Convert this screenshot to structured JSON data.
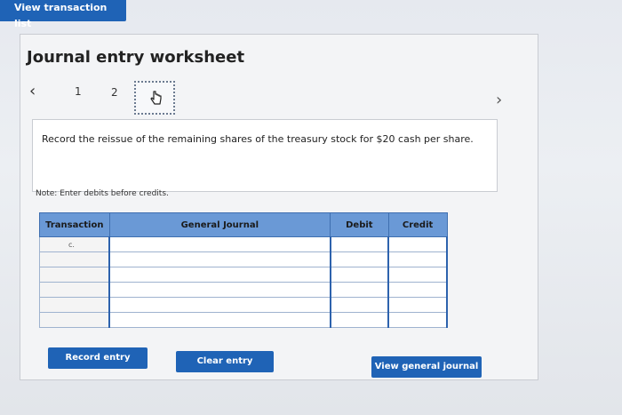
{
  "header": {
    "view_transaction_list": "View transaction list"
  },
  "worksheet": {
    "title": "Journal entry worksheet",
    "pages": [
      "1",
      "2"
    ],
    "instruction": "Record the reissue of the remaining shares of the treasury stock for $20 cash per share.",
    "note": "Note: Enter debits before credits."
  },
  "table": {
    "headers": {
      "transaction": "Transaction",
      "general_journal": "General Journal",
      "debit": "Debit",
      "credit": "Credit"
    },
    "rows": [
      {
        "transaction": "c."
      },
      {
        "transaction": ""
      },
      {
        "transaction": ""
      },
      {
        "transaction": ""
      },
      {
        "transaction": ""
      },
      {
        "transaction": ""
      }
    ]
  },
  "buttons": {
    "record_entry": "Record entry",
    "clear_entry": "Clear entry",
    "view_general_journal": "View general journal"
  },
  "icons": {
    "prev": "chevron-left-icon",
    "next": "chevron-right-icon",
    "current_page": "pointing-hand-icon"
  }
}
